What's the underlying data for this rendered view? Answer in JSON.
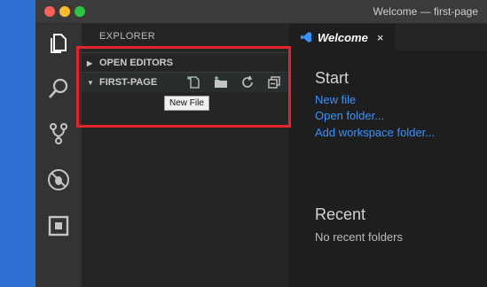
{
  "window": {
    "title": "Welcome — first-page"
  },
  "activity_bar": {
    "icons": [
      "files-icon",
      "search-icon",
      "source-control-icon",
      "debug-icon",
      "extensions-icon"
    ]
  },
  "explorer": {
    "title": "EXPLORER",
    "open_editors": "OPEN EDITORS",
    "folder": "FIRST-PAGE",
    "tooltip": "New File",
    "actions": [
      "new-file-icon",
      "new-folder-icon",
      "refresh-icon",
      "collapse-all-icon"
    ]
  },
  "tab": {
    "label": "Welcome",
    "close": "×"
  },
  "welcome": {
    "start_heading": "Start",
    "start_links": [
      "New file",
      "Open folder...",
      "Add workspace folder..."
    ],
    "recent_heading": "Recent",
    "recent_empty": "No recent folders"
  },
  "colors": {
    "accent_link": "#3794ff",
    "highlight": "#e5242d"
  }
}
